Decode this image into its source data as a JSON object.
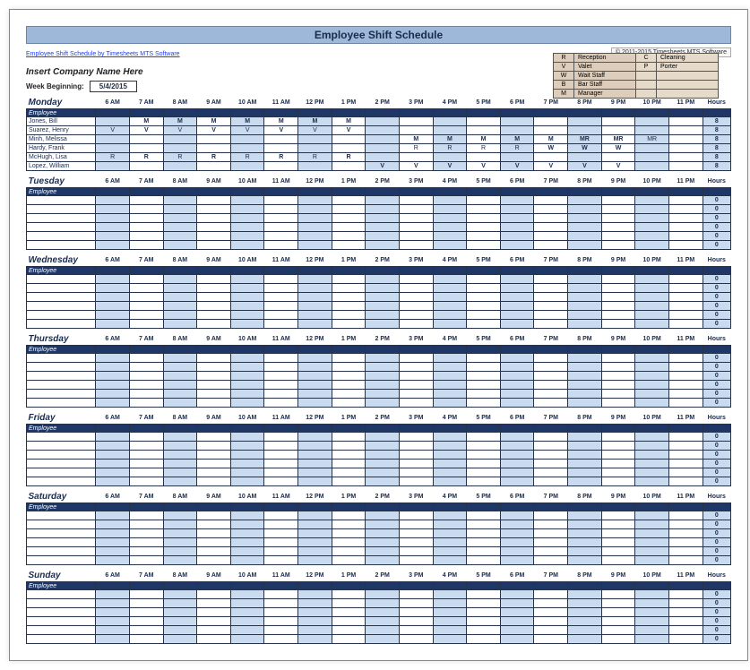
{
  "title": "Employee Shift Schedule",
  "top_link": "Employee Shift Schedule by Timesheets MTS Software",
  "copyright": "© 2011-2015 Timesheets MTS Software",
  "company_placeholder": "Insert Company Name Here",
  "week": {
    "label": "Week Beginning:",
    "value": "5/4/2015"
  },
  "legend": [
    {
      "code": "R",
      "text": "Reception",
      "code2": "C",
      "text2": "Cleaning"
    },
    {
      "code": "V",
      "text": "Valet",
      "code2": "P",
      "text2": "Porter"
    },
    {
      "code": "W",
      "text": "Wait Staff",
      "code2": "",
      "text2": ""
    },
    {
      "code": "B",
      "text": "Bar Staff",
      "code2": "",
      "text2": ""
    },
    {
      "code": "M",
      "text": "Manager",
      "code2": "",
      "text2": ""
    }
  ],
  "hours_header": [
    "6 AM",
    "7 AM",
    "8 AM",
    "9 AM",
    "10 AM",
    "11 AM",
    "12 PM",
    "1 PM",
    "2 PM",
    "3 PM",
    "4 PM",
    "5 PM",
    "6 PM",
    "7 PM",
    "8 PM",
    "9 PM",
    "10 PM",
    "11 PM"
  ],
  "hours_label": "Hours",
  "employee_header": "Employee",
  "days": [
    "Monday",
    "Tuesday",
    "Wednesday",
    "Thursday",
    "Friday",
    "Saturday",
    "Sunday"
  ],
  "monday": {
    "rows": [
      {
        "name": "Jones, Bill",
        "cells": [
          "",
          "M",
          "M",
          "M",
          "M",
          "M",
          "M",
          "M",
          "",
          "",
          "",
          "",
          "",
          "",
          "",
          "",
          "",
          ""
        ],
        "bold": [
          1,
          2,
          3,
          4,
          5,
          6,
          7,
          8
        ],
        "total": "8"
      },
      {
        "name": "Suarez, Henry",
        "cells": [
          "V",
          "V",
          "V",
          "V",
          "V",
          "V",
          "V",
          "V",
          "",
          "",
          "",
          "",
          "",
          "",
          "",
          "",
          "",
          ""
        ],
        "bold": [
          2,
          4,
          6,
          8
        ],
        "total": "8"
      },
      {
        "name": "Minh, Melissa",
        "cells": [
          "",
          "",
          "",
          "",
          "",
          "",
          "",
          "",
          "",
          "M",
          "M",
          "M",
          "M",
          "M",
          "MR",
          "MR",
          "MR",
          ""
        ],
        "bold": [
          10,
          11,
          12,
          13,
          14,
          15,
          16
        ],
        "total": "8"
      },
      {
        "name": "Hardy, Frank",
        "cells": [
          "",
          "",
          "",
          "",
          "",
          "",
          "",
          "",
          "",
          "R",
          "R",
          "R",
          "R",
          "W",
          "W",
          "W",
          "",
          ""
        ],
        "bold": [
          14,
          15,
          16
        ],
        "total": "8"
      },
      {
        "name": "McHugh, Lisa",
        "cells": [
          "R",
          "R",
          "R",
          "R",
          "R",
          "R",
          "R",
          "R",
          "",
          "",
          "",
          "",
          "",
          "",
          "",
          "",
          "",
          ""
        ],
        "bold": [
          2,
          4,
          6,
          8
        ],
        "total": "8"
      },
      {
        "name": "Lopez, William",
        "cells": [
          "",
          "",
          "",
          "",
          "",
          "",
          "",
          "",
          "V",
          "V",
          "V",
          "V",
          "V",
          "V",
          "V",
          "V",
          "",
          ""
        ],
        "bold": [
          9,
          10,
          11,
          12,
          13,
          14,
          15,
          16
        ],
        "total": "8"
      }
    ]
  },
  "empty_totals": [
    "0",
    "0",
    "0",
    "0",
    "0",
    "0"
  ],
  "chart_data": {
    "type": "table",
    "title": "Employee Shift Schedule",
    "week_beginning": "5/4/2015",
    "hours": [
      "6 AM",
      "7 AM",
      "8 AM",
      "9 AM",
      "10 AM",
      "11 AM",
      "12 PM",
      "1 PM",
      "2 PM",
      "3 PM",
      "4 PM",
      "5 PM",
      "6 PM",
      "7 PM",
      "8 PM",
      "9 PM",
      "10 PM",
      "11 PM"
    ],
    "days": {
      "Monday": {
        "Jones, Bill": {
          "6 AM": "",
          "7 AM": "M",
          "8 AM": "M",
          "9 AM": "M",
          "10 AM": "M",
          "11 AM": "M",
          "12 PM": "M",
          "1 PM": "M",
          "2 PM": "",
          "3 PM": "",
          "4 PM": "",
          "5 PM": "",
          "6 PM": "",
          "7 PM": "",
          "8 PM": "",
          "9 PM": "",
          "10 PM": "",
          "11 PM": "",
          "Hours": 8
        },
        "Suarez, Henry": {
          "6 AM": "V",
          "7 AM": "V",
          "8 AM": "V",
          "9 AM": "V",
          "10 AM": "V",
          "11 AM": "V",
          "12 PM": "V",
          "1 PM": "V",
          "2 PM": "",
          "3 PM": "",
          "4 PM": "",
          "5 PM": "",
          "6 PM": "",
          "7 PM": "",
          "8 PM": "",
          "9 PM": "",
          "10 PM": "",
          "11 PM": "",
          "Hours": 8
        },
        "Minh, Melissa": {
          "6 AM": "",
          "7 AM": "",
          "8 AM": "",
          "9 AM": "",
          "10 AM": "",
          "11 AM": "",
          "12 PM": "",
          "1 PM": "",
          "2 PM": "",
          "3 PM": "M",
          "4 PM": "M",
          "5 PM": "M",
          "6 PM": "M",
          "7 PM": "M",
          "8 PM": "MR",
          "9 PM": "MR",
          "10 PM": "MR",
          "11 PM": "",
          "Hours": 8
        },
        "Hardy, Frank": {
          "6 AM": "",
          "7 AM": "",
          "8 AM": "",
          "9 AM": "",
          "10 AM": "",
          "11 AM": "",
          "12 PM": "",
          "1 PM": "",
          "2 PM": "",
          "3 PM": "R",
          "4 PM": "R",
          "5 PM": "R",
          "6 PM": "R",
          "7 PM": "W",
          "8 PM": "W",
          "9 PM": "W",
          "10 PM": "",
          "11 PM": "",
          "Hours": 8
        },
        "McHugh, Lisa": {
          "6 AM": "R",
          "7 AM": "R",
          "8 AM": "R",
          "9 AM": "R",
          "10 AM": "R",
          "11 AM": "R",
          "12 PM": "R",
          "1 PM": "R",
          "2 PM": "",
          "3 PM": "",
          "4 PM": "",
          "5 PM": "",
          "6 PM": "",
          "7 PM": "",
          "8 PM": "",
          "9 PM": "",
          "10 PM": "",
          "11 PM": "",
          "Hours": 8
        },
        "Lopez, William": {
          "6 AM": "",
          "7 AM": "",
          "8 AM": "",
          "9 AM": "",
          "10 AM": "",
          "11 AM": "",
          "12 PM": "",
          "1 PM": "",
          "2 PM": "V",
          "3 PM": "V",
          "4 PM": "V",
          "5 PM": "V",
          "6 PM": "V",
          "7 PM": "V",
          "8 PM": "V",
          "9 PM": "V",
          "10 PM": "",
          "11 PM": "",
          "Hours": 8
        }
      },
      "Tuesday": {},
      "Wednesday": {},
      "Thursday": {},
      "Friday": {},
      "Saturday": {},
      "Sunday": {}
    },
    "legend": {
      "R": "Reception",
      "V": "Valet",
      "W": "Wait Staff",
      "B": "Bar Staff",
      "M": "Manager",
      "C": "Cleaning",
      "P": "Porter"
    }
  }
}
